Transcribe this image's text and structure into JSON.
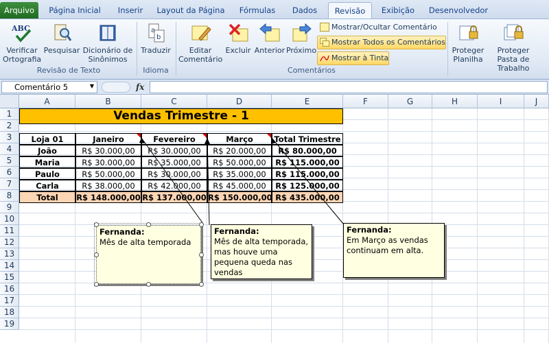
{
  "tabs": [
    {
      "label": "Arquivo"
    },
    {
      "label": "Página Inicial"
    },
    {
      "label": "Inserir"
    },
    {
      "label": "Layout da Página"
    },
    {
      "label": "Fórmulas"
    },
    {
      "label": "Dados"
    },
    {
      "label": "Revisão"
    },
    {
      "label": "Exibição"
    },
    {
      "label": "Desenvolvedor"
    }
  ],
  "ribbon": {
    "spelling": "Verificar Ortografia",
    "research": "Pesquisar",
    "thesaurus": "Dicionário de Sinônimos",
    "group_proofing": "Revisão de Texto",
    "translate": "Traduzir",
    "group_language": "Idioma",
    "edit_comment": "Editar Comentário",
    "delete": "Excluir",
    "previous": "Anterior",
    "next": "Próximo",
    "show_hide": "Mostrar/Ocultar Comentário",
    "show_all": "Mostrar Todos os Comentários",
    "show_ink": "Mostrar à Tinta",
    "group_comments": "Comentários",
    "protect_sheet": "Proteger Planilha",
    "protect_workbook": "Proteger Pasta de Trabalho",
    "abc_text": "ABC"
  },
  "formula_bar": {
    "name_box": "Comentário 5",
    "fx": "fx",
    "value": ""
  },
  "columns": [
    "A",
    "B",
    "C",
    "D",
    "E",
    "F",
    "G",
    "H",
    "I",
    "J"
  ],
  "rows": [
    "1",
    "2",
    "3",
    "4",
    "5",
    "6",
    "7",
    "8",
    "9",
    "10",
    "11",
    "12",
    "13",
    "14",
    "15",
    "16",
    "17",
    "18",
    "19"
  ],
  "sheet": {
    "title": "Vendas Trimestre - 1",
    "headers": [
      "Loja 01",
      "Janeiro",
      "Fevereiro",
      "Março",
      "Total Trimestre"
    ],
    "data": [
      [
        "João",
        "R$ 30.000,00",
        "R$ 30.000,00",
        "R$ 20.000,00",
        "R$ 80.000,00"
      ],
      [
        "Maria",
        "R$ 30.000,00",
        "R$ 35.000,00",
        "R$ 50.000,00",
        "R$ 115.000,00"
      ],
      [
        "Paulo",
        "R$ 50.000,00",
        "R$ 30.000,00",
        "R$ 35.000,00",
        "R$ 115.000,00"
      ],
      [
        "Carla",
        "R$ 38.000,00",
        "R$ 42.000,00",
        "R$ 45.000,00",
        "R$ 125.000,00"
      ]
    ],
    "totals": [
      "Total",
      "R$ 148.000,00",
      "R$ 137.000,00",
      "R$ 150.000,00",
      "R$ 435.000,00"
    ]
  },
  "comments": [
    {
      "author": "Fernanda:",
      "text": "Mês de alta temporada"
    },
    {
      "author": "Fernanda:",
      "text": "Mês de alta temporada, mas houve uma pequena queda nas vendas"
    },
    {
      "author": "Fernanda:",
      "text": "Em Março as vendas continuam em alta."
    }
  ],
  "colors": {
    "title_fill": "#ffc000",
    "total_fill": "#fcd5b4",
    "comment_fill": "#ffffe1",
    "file_tab": "#2a7b2e"
  }
}
